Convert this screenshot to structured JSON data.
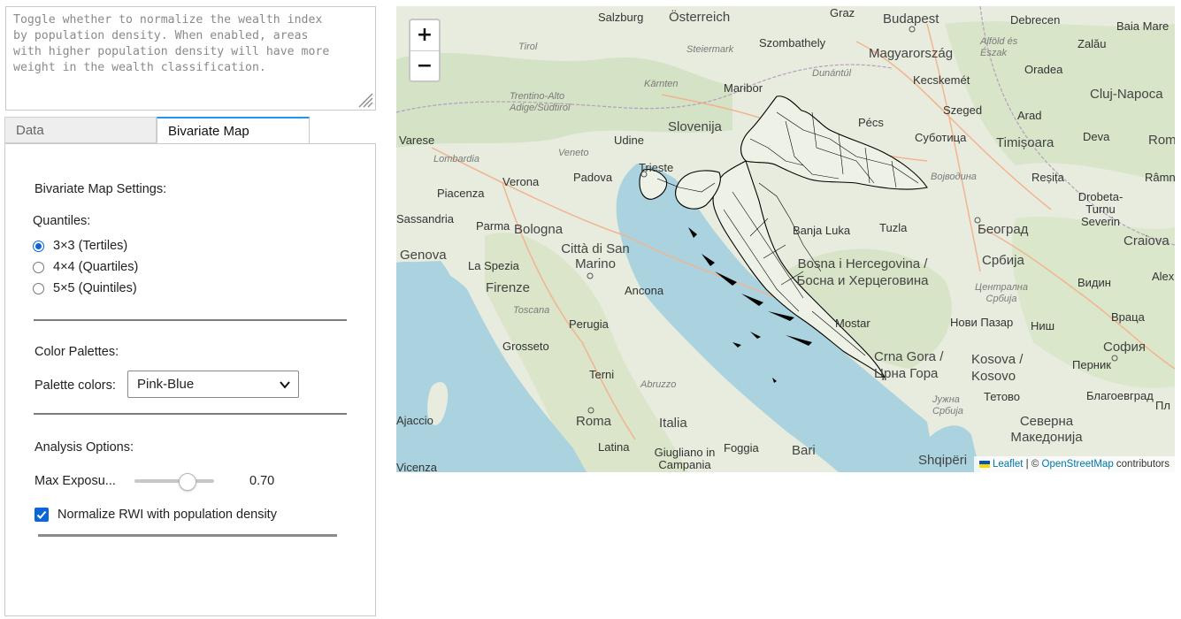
{
  "help": {
    "text": "Toggle whether to normalize the wealth index\nby population density. When enabled, areas\nwith higher population density will have more\nweight in the wealth classification."
  },
  "tabs": [
    {
      "label": "Data"
    },
    {
      "label": "Bivariate Map"
    }
  ],
  "settings": {
    "heading": "Bivariate Map Settings:",
    "quantiles_label": "Quantiles:",
    "quantile_options": [
      {
        "label": "3×3 (Tertiles)",
        "selected": true
      },
      {
        "label": "4×4 (Quartiles)",
        "selected": false
      },
      {
        "label": "5×5 (Quintiles)",
        "selected": false
      }
    ],
    "palettes_heading": "Color Palettes:",
    "palette_label": "Palette colors:",
    "palette_value": "Pink-Blue",
    "analysis_heading": "Analysis Options:",
    "max_exposure_label": "Max Exposu...",
    "max_exposure_value": "0.70",
    "normalize_label": "Normalize RWI with population density",
    "normalize_checked": true
  },
  "map": {
    "zoom_in": "+",
    "zoom_out": "−",
    "attribution": {
      "leaflet": "Leaflet",
      "sep": " | © ",
      "osm": "OpenStreetMap",
      "suffix": " contributors"
    },
    "places": [
      "Salzburg",
      "Österreich",
      "Graz",
      "Budapest",
      "Debrecen",
      "Baia Mare",
      "Tirol",
      "Steiermark",
      "Szombathely",
      "Magyarország",
      "Alföld és Észak",
      "Zalău",
      "Kärnten",
      "Dunántúl",
      "Kecskemét",
      "Oradea",
      "Cluj-Napoca",
      "Trentino-Alto Adige/Südtirol",
      "Maribor",
      "Slovenija",
      "Pécs",
      "Szeged",
      "Arad",
      "Udine",
      "Varese",
      "Lombardia",
      "Veneto",
      "Суботица",
      "Timișoara",
      "Deva",
      "Româ",
      "Trieste",
      "Padova",
      "Verona",
      "Piacenza",
      "Војводина",
      "Reșița",
      "Drobeta-Turnu Severin",
      "Râmn",
      "Parma",
      "Bologna",
      "Banja Luka",
      "Tuzla",
      "Београд",
      "Craiova",
      "Genova",
      "La Spezia",
      "Città di San Marino",
      "Bosna i Hercegovina / Босна и Херцеговина",
      "Србија",
      "Firenze",
      "Ancona",
      "Централна Србија",
      "Видин",
      "Alex",
      "Toscana",
      "Perugia",
      "Нови Пазар",
      "Ниш",
      "Враца",
      "Grosseto",
      "Mostar",
      "Crna Gora / Црна Гора",
      "Kosova / Kosovo",
      "София",
      "Перник",
      "Terni",
      "Abruzzo",
      "Тетово",
      "Благоевград",
      "Пл",
      "Roma",
      "Italia",
      "Јужна Србија",
      "Северна Македонија",
      "Shqipëri",
      "Latina",
      "Foggia",
      "Bari",
      "Giugliano in Campania",
      "Ajaccio",
      "Vicenza",
      "Sassandria"
    ]
  }
}
